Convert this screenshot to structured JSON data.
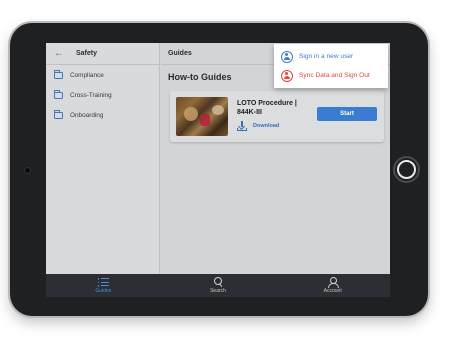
{
  "sidebar": {
    "title": "Safety",
    "items": [
      {
        "label": "Compliance"
      },
      {
        "label": "Cross-Training"
      },
      {
        "label": "Onboarding"
      }
    ]
  },
  "main": {
    "header_title": "Guides",
    "section_title": "How-to Guides",
    "card": {
      "title": "LOTO Procedure | 844K-III",
      "download_label": "Download",
      "start_label": "Start"
    }
  },
  "dropdown": {
    "items": [
      {
        "label": "Sign in a new user",
        "icon": "user-circle-icon",
        "color": "#3a7ccf"
      },
      {
        "label": "Sync Data and Sign Out",
        "icon": "user-circle-icon",
        "color": "#e0483f"
      }
    ]
  },
  "tabbar": {
    "tabs": [
      {
        "label": "Guides",
        "icon": "list-icon",
        "active": true
      },
      {
        "label": "Search",
        "icon": "search-icon",
        "active": false
      },
      {
        "label": "Account",
        "icon": "account-icon",
        "active": false
      }
    ]
  },
  "colors": {
    "accent": "#3a7ccf",
    "danger": "#e0483f",
    "tabbar_bg": "#2b2e33"
  }
}
